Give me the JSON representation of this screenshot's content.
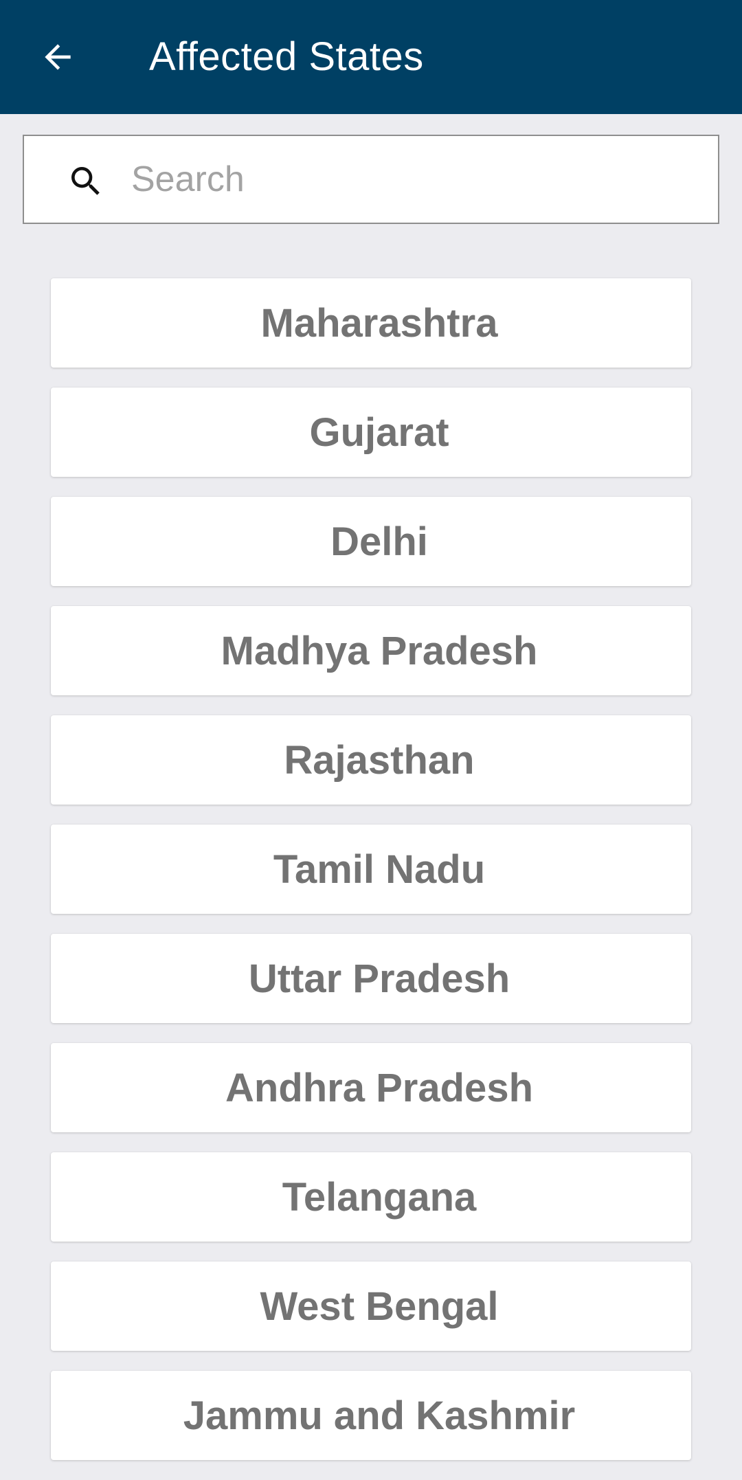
{
  "header": {
    "title": "Affected States",
    "back_icon": "arrow-left-icon",
    "background": "#004064"
  },
  "search": {
    "placeholder": "Search",
    "value": "",
    "icon": "search-icon"
  },
  "states": [
    {
      "label": "Maharashtra"
    },
    {
      "label": "Gujarat"
    },
    {
      "label": "Delhi"
    },
    {
      "label": "Madhya Pradesh"
    },
    {
      "label": "Rajasthan"
    },
    {
      "label": "Tamil Nadu"
    },
    {
      "label": "Uttar Pradesh"
    },
    {
      "label": "Andhra Pradesh"
    },
    {
      "label": "Telangana"
    },
    {
      "label": "West Bengal"
    },
    {
      "label": "Jammu and Kashmir"
    }
  ]
}
